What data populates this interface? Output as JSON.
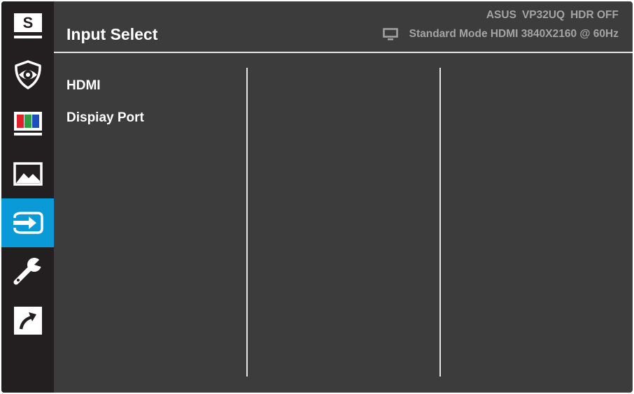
{
  "header": {
    "title": "Input Select",
    "model_info": [
      "ASUS",
      "VP32UQ",
      "HDR OFF"
    ],
    "status": "Standard Mode HDMI 3840X2160 @ 60Hz",
    "status_icon": "monitor-icon"
  },
  "sidebar": {
    "items": [
      {
        "name": "splendid",
        "icon": "splendid-s-icon",
        "label": "S"
      },
      {
        "name": "blue-light-filter",
        "icon": "eye-icon"
      },
      {
        "name": "color",
        "icon": "color-bars-icon"
      },
      {
        "name": "image",
        "icon": "landscape-icon"
      },
      {
        "name": "input-select",
        "icon": "input-arrow-icon",
        "active": true
      },
      {
        "name": "system-setup",
        "icon": "wrench-icon"
      },
      {
        "name": "shortcut",
        "icon": "shortcut-arrow-icon"
      }
    ]
  },
  "menu": {
    "items": [
      {
        "label": "HDMI"
      },
      {
        "label": "Dispiay Port"
      }
    ]
  },
  "colors": {
    "background": "#3c3c3c",
    "sidebar": "#231f20",
    "active": "#0a9ad8",
    "text": "#ffffff",
    "muted_text": "#a4a4a4"
  }
}
